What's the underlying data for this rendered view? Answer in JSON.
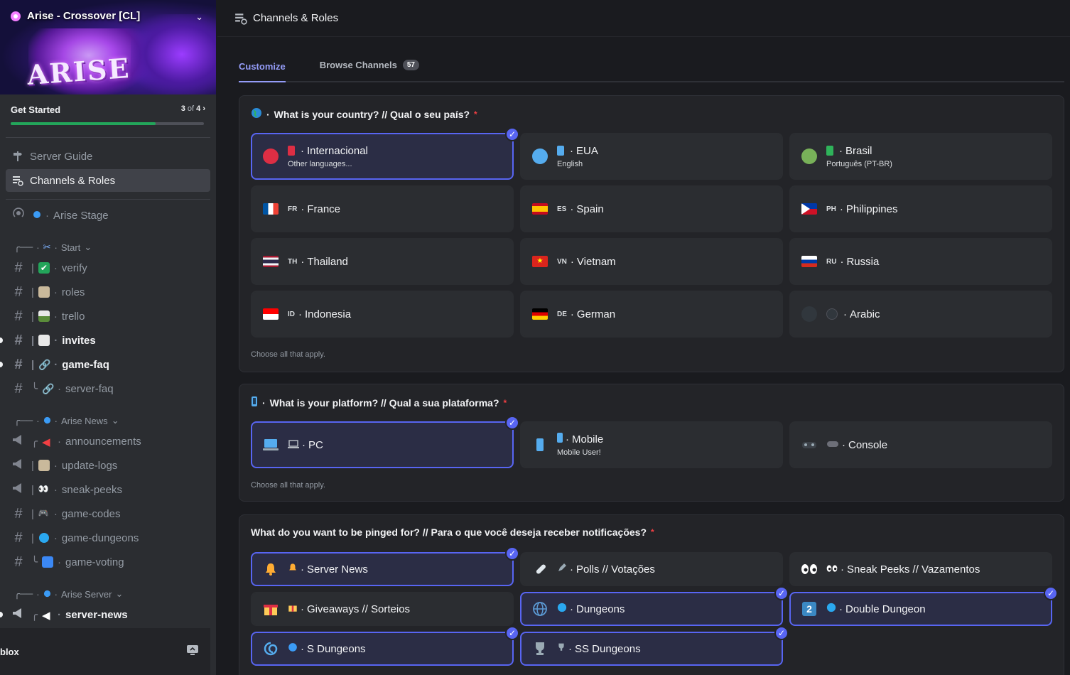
{
  "server": {
    "name": "Arise - Crossover [CL]",
    "banner_logo": "ARISE"
  },
  "get_started": {
    "label": "Get Started",
    "progress_done": "3",
    "progress_of": "of",
    "progress_total": "4",
    "fraction": 0.75
  },
  "nav": {
    "server_guide": "Server Guide",
    "channels_roles": "Channels & Roles"
  },
  "stage": {
    "label": "Arise Stage"
  },
  "categories": {
    "start": "Start",
    "news": "Arise News",
    "server": "Arise Server"
  },
  "channels": {
    "verify": "verify",
    "roles": "roles",
    "trello": "trello",
    "invites": "invites",
    "game_faq": "game-faq",
    "server_faq": "server-faq",
    "announcements": "announcements",
    "update_logs": "update-logs",
    "sneak_peeks": "sneak-peeks",
    "game_codes": "game-codes",
    "game_dungeons": "game-dungeons",
    "game_voting": "game-voting",
    "server_news": "server-news"
  },
  "user": {
    "name": "blox"
  },
  "header": {
    "title": "Channels & Roles"
  },
  "tabs": {
    "customize": "Customize",
    "browse": "Browse Channels",
    "browse_count": "57"
  },
  "q1": {
    "question": "What is your country? // Qual o seu país?",
    "hint": "Choose all that apply.",
    "options": {
      "intl": {
        "label": "Internacional",
        "sub": "Other languages..."
      },
      "eua": {
        "label": "EUA",
        "sub": "English"
      },
      "brasil": {
        "label": "Brasil",
        "sub": "Português (PT-BR)"
      },
      "france": {
        "code": "FR",
        "label": "France"
      },
      "spain": {
        "code": "ES",
        "label": "Spain"
      },
      "philippines": {
        "code": "PH",
        "label": "Philippines"
      },
      "thailand": {
        "code": "TH",
        "label": "Thailand"
      },
      "vietnam": {
        "code": "VN",
        "label": "Vietnam"
      },
      "russia": {
        "code": "RU",
        "label": "Russia"
      },
      "indonesia": {
        "code": "ID",
        "label": "Indonesia"
      },
      "german": {
        "code": "DE",
        "label": "German"
      },
      "arabic": {
        "label": "Arabic"
      }
    }
  },
  "q2": {
    "question": "What is your platform? // Qual a sua plataforma?",
    "hint": "Choose all that apply.",
    "options": {
      "pc": {
        "label": "PC"
      },
      "mobile": {
        "label": "Mobile",
        "sub": "Mobile User!"
      },
      "console": {
        "label": "Console"
      }
    }
  },
  "q3": {
    "question": "What do you want to be pinged for? // Para o que você deseja receber notificações?",
    "options": {
      "server_news": {
        "label": "Server News"
      },
      "polls": {
        "label": "Polls // Votações"
      },
      "sneak": {
        "label": "Sneak Peeks // Vazamentos"
      },
      "giveaways": {
        "label": "Giveaways // Sorteios"
      },
      "dungeons": {
        "label": "Dungeons"
      },
      "double": {
        "label": "Double Dungeon"
      },
      "s_dungeons": {
        "label": "S Dungeons"
      },
      "ss_dungeons": {
        "label": "SS Dungeons"
      }
    }
  },
  "colors": {
    "accent": "#5865f2",
    "progress": "#23a55a",
    "required": "#f23f43"
  }
}
